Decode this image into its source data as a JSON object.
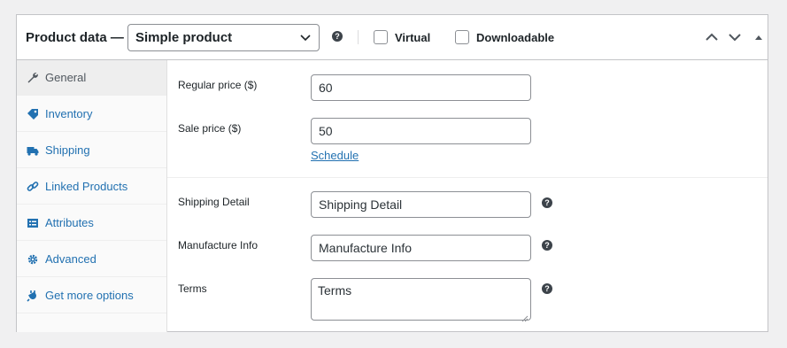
{
  "header": {
    "title": "Product data —",
    "product_type": "Simple product",
    "help": "?",
    "virtual_label": "Virtual",
    "virtual_checked": false,
    "downloadable_label": "Downloadable",
    "downloadable_checked": false
  },
  "tabs": [
    {
      "label": "General",
      "icon": "wrench-icon",
      "active": true
    },
    {
      "label": "Inventory",
      "icon": "tag-icon",
      "active": false
    },
    {
      "label": "Shipping",
      "icon": "truck-icon",
      "active": false
    },
    {
      "label": "Linked Products",
      "icon": "link-icon",
      "active": false
    },
    {
      "label": "Attributes",
      "icon": "list-icon",
      "active": false
    },
    {
      "label": "Advanced",
      "icon": "gear-icon",
      "active": false
    },
    {
      "label": "Get more options",
      "icon": "plugin-icon",
      "active": false
    }
  ],
  "pricing": {
    "regular_price_label": "Regular price ($)",
    "regular_price_value": "60",
    "sale_price_label": "Sale price ($)",
    "sale_price_value": "50",
    "schedule_link": "Schedule"
  },
  "custom_fields": {
    "shipping_detail_label": "Shipping Detail",
    "shipping_detail_value": "Shipping Detail",
    "manufacture_info_label": "Manufacture Info",
    "manufacture_info_value": "Manufacture Info",
    "terms_label": "Terms",
    "terms_value": "Terms"
  },
  "colors": {
    "link": "#2271b1",
    "border": "#c3c4c7",
    "background": "#f0f0f1"
  }
}
